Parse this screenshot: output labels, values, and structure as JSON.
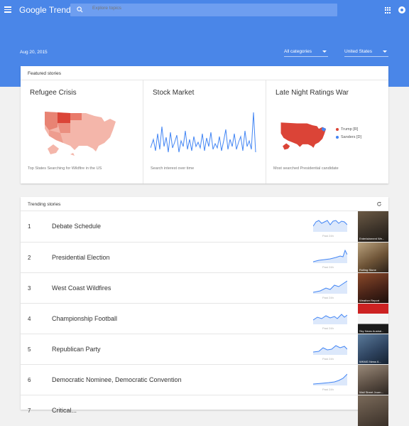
{
  "app": {
    "logo": "Google Trends",
    "search_placeholder": "Explore topics"
  },
  "toolbar": {
    "date": "Aug 20, 2015",
    "category": "All categories",
    "region": "United States"
  },
  "featured": {
    "header": "Featured stories",
    "stories": [
      {
        "title": "Refugee Crisis",
        "caption": "Top States Searching for Wildfire in the US"
      },
      {
        "title": "Stock Market",
        "caption": "Search interest over time"
      },
      {
        "title": "Late Night Ratings War",
        "caption": "Most searched Presidential candidate",
        "legend": [
          {
            "label": "Trump [R]",
            "color": "#db4437"
          },
          {
            "label": "Sanders [D]",
            "color": "#4285f4"
          }
        ]
      }
    ]
  },
  "trending": {
    "header": "Trending stories",
    "spark_label": "Past 24h",
    "items": [
      {
        "rank": "1",
        "title": "Debate Schedule",
        "thumb_caption": "Entertainment We..."
      },
      {
        "rank": "2",
        "title": "Presidential Election",
        "thumb_caption": "Rolling Stone"
      },
      {
        "rank": "3",
        "title": "West Coast Wildfires",
        "thumb_caption": "Weather Report"
      },
      {
        "rank": "4",
        "title": "Championship Football",
        "thumb_caption": "Sky News Austral..."
      },
      {
        "rank": "5",
        "title": "Republican Party",
        "thumb_caption": "WKMG News 6..."
      },
      {
        "rank": "6",
        "title": "Democratic Nominee, Democratic Convention",
        "thumb_caption": "Wall Street Journ..."
      },
      {
        "rank": "7",
        "title": "Critical...",
        "thumb_caption": ""
      }
    ]
  },
  "colors": {
    "header_blue": "#4a86e8",
    "line_blue": "#4285f4",
    "map_red": "#db4437"
  }
}
